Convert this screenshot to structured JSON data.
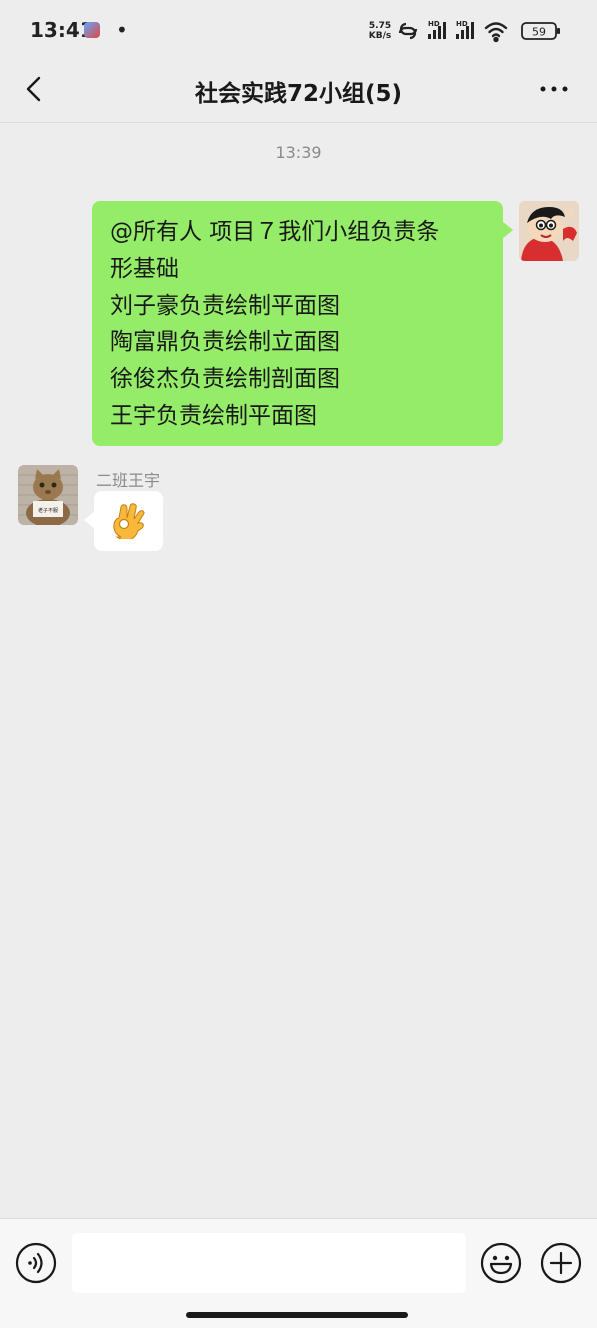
{
  "status_bar": {
    "time": "13:41",
    "dot": "•",
    "net_speed_value": "5.75",
    "net_speed_unit": "KB/s",
    "hd1": "HD",
    "hd2": "HD",
    "battery": "59"
  },
  "header": {
    "title": "社会实践72小组(5)"
  },
  "chat": {
    "timestamp": "13:39",
    "messages": [
      {
        "direction": "outgoing",
        "lines": [
          "@所有人 项目７我们小组负责条",
          "形基础",
          "刘子豪负责绘制平面图",
          "陶富鼎负责绘制立面图",
          "徐俊杰负责绘制剖面图",
          "王宇负责绘制平面图"
        ]
      },
      {
        "direction": "incoming",
        "sender": "二班王宇",
        "content": "ok-hand-emoji",
        "avatar_sign": "老子不服"
      }
    ]
  },
  "input_bar": {
    "input_value": "",
    "icons": [
      "voice-icon",
      "emoji-face-icon",
      "plus-icon"
    ]
  },
  "colors": {
    "background": "#ededed",
    "outgoing_bubble": "#95ec69",
    "incoming_bubble": "#ffffff"
  }
}
